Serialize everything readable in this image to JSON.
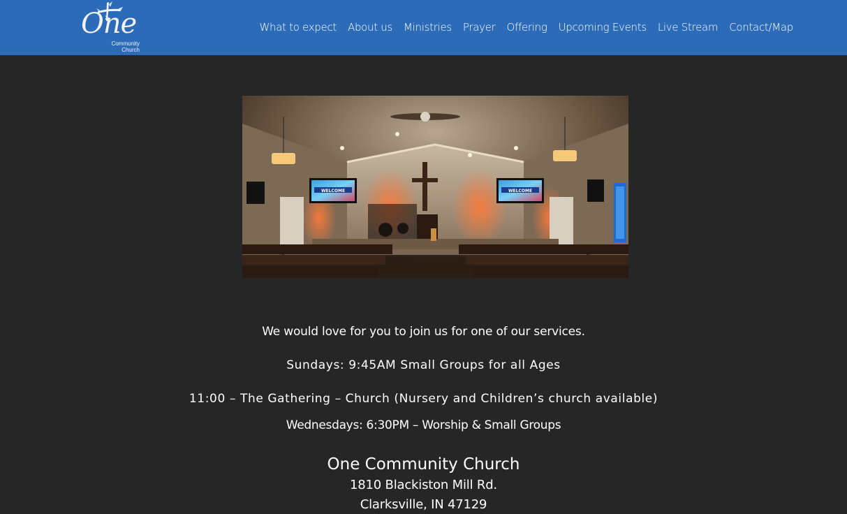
{
  "header": {
    "logo": {
      "word": "One",
      "subtitle_line1": "Community",
      "subtitle_line2": "Church",
      "icon": "cross-icon"
    },
    "nav": [
      {
        "label": "What to expect"
      },
      {
        "label": "About us"
      },
      {
        "label": "Ministries"
      },
      {
        "label": "Prayer"
      },
      {
        "label": "Offering"
      },
      {
        "label": "Upcoming Events"
      },
      {
        "label": "Live Stream"
      },
      {
        "label": "Contact/Map"
      }
    ]
  },
  "hero": {
    "screen_text_left": "WELCOME",
    "screen_text_right": "WELCOME"
  },
  "services": {
    "intro": "We would love for you to join us for one of our services.",
    "sunday": "Sundays: 9:45AM Small Groups for all Ages",
    "gathering": "11:00 – The Gathering – Church (Nursery and Children’s church available)",
    "wednesday": "Wednesdays: 6:30PM – Worship & Small Groups"
  },
  "address": {
    "name": "One Community Church",
    "street": "1810 Blackiston Mill Rd.",
    "city": "Clarksville, IN 47129"
  },
  "colors": {
    "header_bg": "#2c6bb8",
    "page_bg": "#262626",
    "text": "#ffffff"
  }
}
